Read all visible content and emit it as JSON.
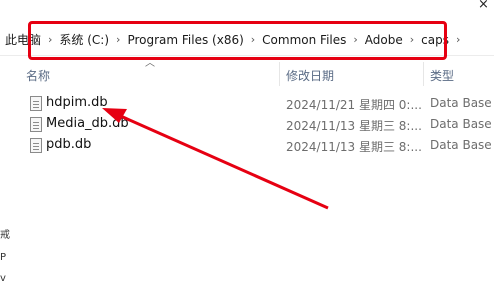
{
  "window": {
    "close_glyph": "×"
  },
  "breadcrumb": [
    "此电脑",
    "系统 (C:)",
    "Program Files (x86)",
    "Common Files",
    "Adobe",
    "caps"
  ],
  "breadcrumb_separator": "›",
  "columns": {
    "name": "名称",
    "modified": "修改日期",
    "type": "类型"
  },
  "files": [
    {
      "name": "hdpim.db",
      "modified": "2024/11/21 星期四 0:...",
      "type": "Data Base"
    },
    {
      "name": "Media_db.db",
      "modified": "2024/11/13 星期三 8:...",
      "type": "Data Base"
    },
    {
      "name": "pdb.db",
      "modified": "2024/11/13 星期三 8:...",
      "type": "Data Base"
    }
  ],
  "annotation": {
    "color": "#e60012"
  },
  "left_pane_fragments": [
    "戒",
    "P",
    "v"
  ]
}
